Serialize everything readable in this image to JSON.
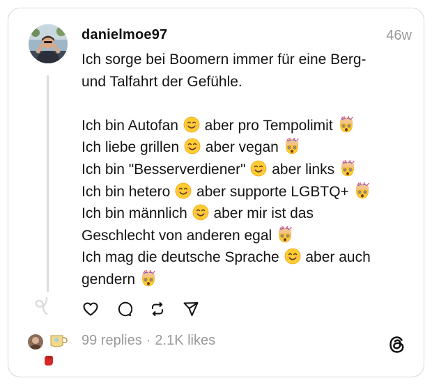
{
  "post": {
    "username": "danielmoe97",
    "timestamp": "46w",
    "text": {
      "intro_line_1": "Ich sorge bei Boomern immer für eine Berg-",
      "intro_line_2": "und Talfahrt der Gefühle.",
      "l1a": "Ich bin Autofan",
      "l1b": "aber pro Tempolimit",
      "l2a": "Ich liebe grillen",
      "l2b": "aber vegan",
      "l3a": "Ich bin \"Besserverdiener\"",
      "l3b": "aber links",
      "l4a": "Ich bin hetero",
      "l4b": "aber supporte LGBTQ+",
      "l5a": "Ich bin männlich",
      "l5b": "aber mir ist das",
      "l5c": "Geschlecht von anderen egal",
      "l6a": "Ich mag die deutsche Sprache",
      "l6b": "aber auch",
      "l6c": "gendern"
    },
    "emoji": {
      "smile": "smiling-face-icon",
      "exploding": "exploding-head-icon"
    }
  },
  "actions": {
    "like": "heart-icon",
    "reply": "comment-bubble-icon",
    "repost": "repost-icon",
    "share": "send-icon"
  },
  "stats": {
    "replies": "99 replies",
    "separator": "·",
    "likes": "2.1K likes"
  },
  "colors": {
    "text": "#141414",
    "muted": "#999999",
    "border": "#d8d8d8",
    "emoji_yellow": "#ffcc33"
  }
}
